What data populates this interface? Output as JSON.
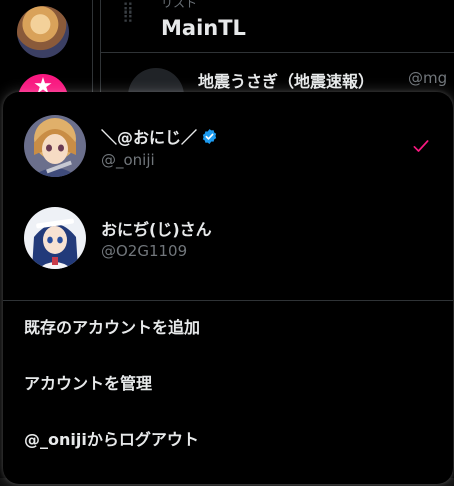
{
  "column": {
    "kicker": "リスト",
    "title": "MainTL"
  },
  "tweet": {
    "author_name": "地震うさぎ（地震速報）",
    "author_handle": "@mg"
  },
  "account_menu": {
    "accounts": [
      {
        "name": "＼@おにじ／",
        "handle": "@_oniji",
        "verified": true,
        "selected": true
      },
      {
        "name": "おにぢ(じ)さん",
        "handle": "@O2G1109",
        "verified": false,
        "selected": false
      }
    ],
    "actions": {
      "add_existing": "既存のアカウントを追加",
      "manage": "アカウントを管理",
      "logout": "@_onijiからログアウト"
    }
  },
  "colors": {
    "accent": "#f91880",
    "verified": "#1d9bf0",
    "text_primary": "#e7e9ea",
    "text_secondary": "#71767b",
    "divider": "#2f3336"
  },
  "icons": {
    "verified": "verified-badge-icon",
    "selected": "checkmark-icon",
    "drag": "drag-handle-icon",
    "sidebar_add": "star-icon"
  }
}
